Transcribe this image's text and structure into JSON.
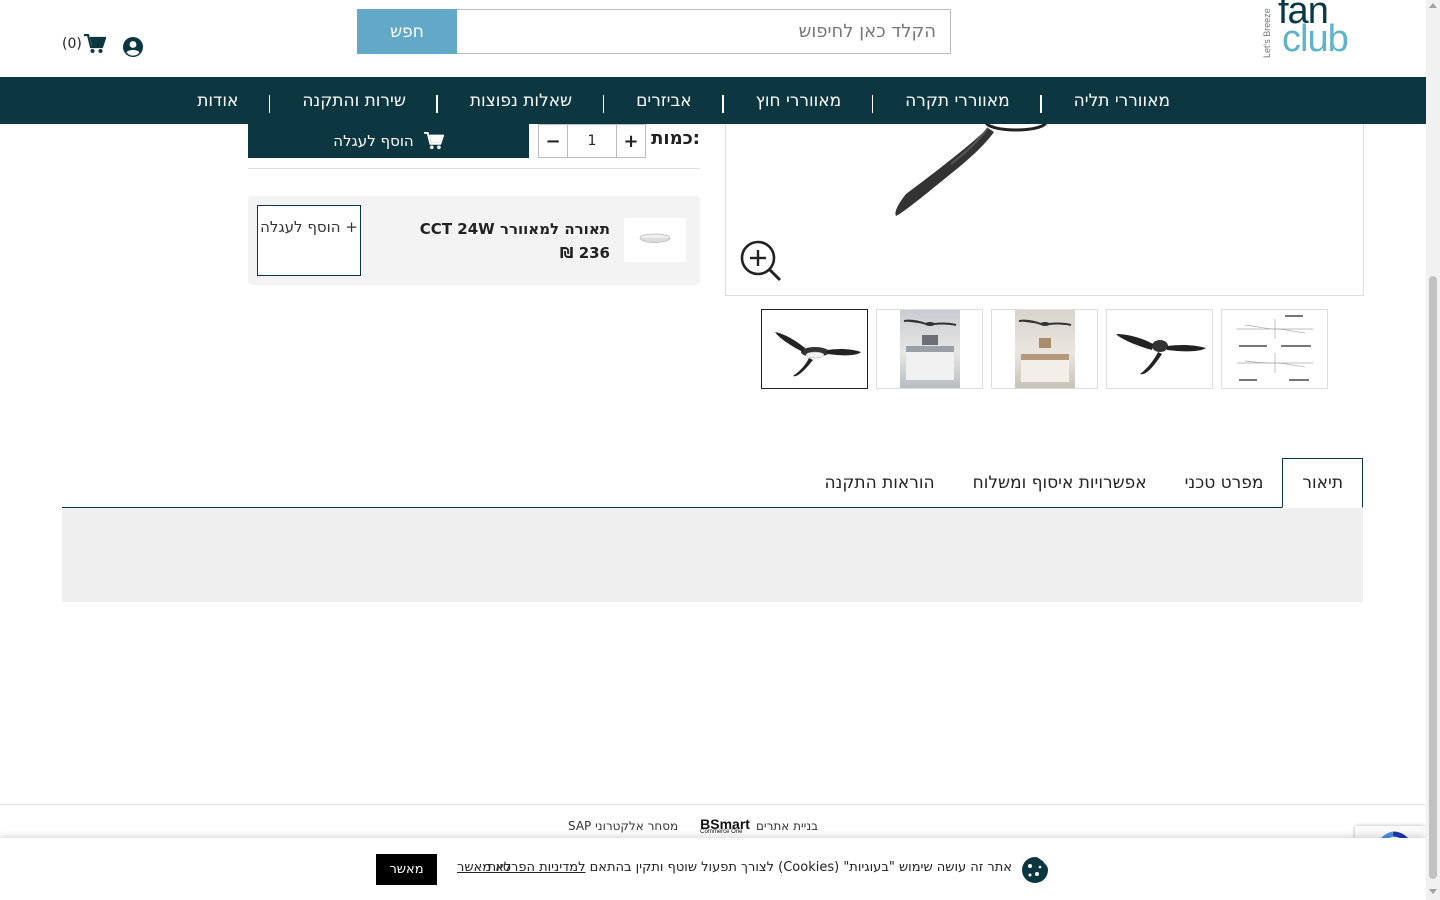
{
  "header": {
    "logo": {
      "tagline": "Let's Breeze",
      "word1": "fan",
      "word2": "club"
    },
    "search": {
      "button_label": "חפש",
      "placeholder": "הקלד כאן לחיפוש"
    },
    "cart_count": "(0)"
  },
  "nav": {
    "items": [
      "מאווררי תליה",
      "מאווררי תקרה",
      "מאווררי חוץ",
      "אביזרים",
      "שאלות נפוצות",
      "שירות והתקנה",
      "אודות"
    ]
  },
  "buy": {
    "add_to_cart_label": "הוסף לעגלה",
    "quantity_label": "כמות:",
    "quantity_value": "1",
    "plus": "+",
    "minus": "−"
  },
  "addon": {
    "title": "תאורה למאוורר CCT 24W",
    "price": "236 ₪",
    "button_label": "+ הוסף לעגלה"
  },
  "tabs": [
    {
      "label": "תיאור",
      "active": true
    },
    {
      "label": "מפרט טכני",
      "active": false
    },
    {
      "label": "אפשרויות איסוף ומשלוח",
      "active": false
    },
    {
      "label": "הוראות התקנה",
      "active": false
    }
  ],
  "footer": {
    "credit_text": "בניית אתרים",
    "credit_brand": "BSmart",
    "credit_brand_sub": "Commerce One",
    "credit_sap": "SAP מסחר אלקטרוני"
  },
  "cookie": {
    "text": "אתר זה עושה שימוש \"בעוגיות\" (Cookies) לצורך תפעול שוטף ותקין בהתאם",
    "policy_link": "למדיניות הפרטיות",
    "decline": "לא מאשר",
    "accept": "מאשר"
  },
  "colors": {
    "brand_dark": "#0c3740",
    "brand_light": "#62a8c7"
  }
}
